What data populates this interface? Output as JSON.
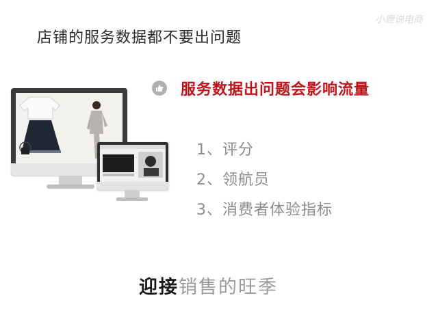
{
  "slide": {
    "title": "店铺的服务数据都不要出问题",
    "highlight": "服务数据出问题会影响流量",
    "list": [
      "1、评分",
      "2、领航员",
      "3、消费者体验指标"
    ],
    "footer_strong": "迎接",
    "footer_soft": "销售的旺季",
    "watermark": "小鹿说电商"
  },
  "icons": {
    "bullet": "thumbs-up-icon"
  },
  "colors": {
    "accent": "#c0141b",
    "list": "#8c8c8c",
    "title": "#2a2a2a"
  }
}
